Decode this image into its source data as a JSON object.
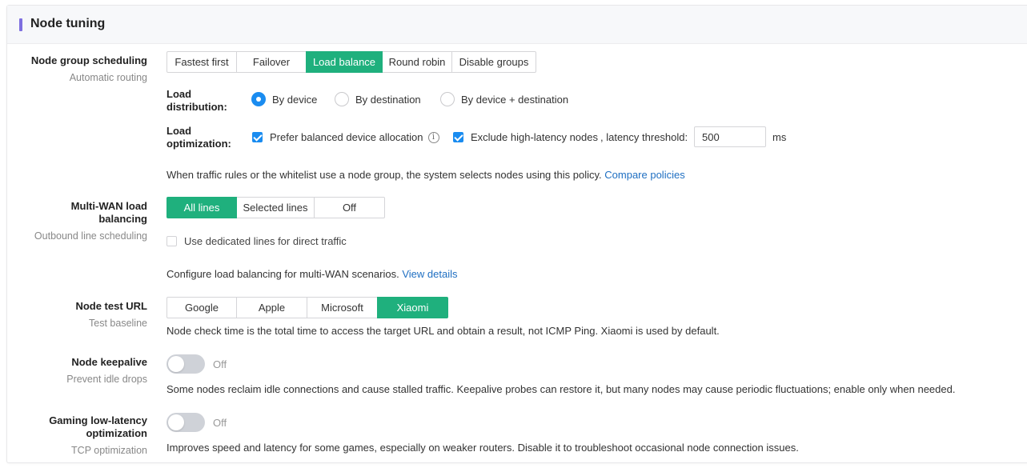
{
  "header": {
    "title": "Node tuning"
  },
  "group_scheduling": {
    "label": "Node group scheduling",
    "sublabel": "Automatic routing",
    "options": [
      "Fastest first",
      "Failover",
      "Load balance",
      "Round robin",
      "Disable groups"
    ],
    "selected": "Load balance",
    "distribution": {
      "label_line1": "Load",
      "label_line2": "distribution:",
      "options": [
        "By device",
        "By destination",
        "By device + destination"
      ],
      "selected": "By device"
    },
    "optimization": {
      "label_line1": "Load",
      "label_line2": "optimization:",
      "prefer_balanced": {
        "label": "Prefer balanced device allocation",
        "checked": true
      },
      "exclude_high_latency": {
        "label": "Exclude high-latency nodes",
        "checked": true
      },
      "threshold_label": ", latency threshold:",
      "threshold_value": "500",
      "threshold_unit": "ms"
    },
    "help_text": "When traffic rules or the whitelist use a node group, the system selects nodes using this policy.",
    "help_link": "Compare policies"
  },
  "multiwan": {
    "label_line1": "Multi-WAN load",
    "label_line2": "balancing",
    "sublabel": "Outbound line scheduling",
    "options": [
      "All lines",
      "Selected lines",
      "Off"
    ],
    "selected": "All lines",
    "dedicated_lines": {
      "label": "Use dedicated lines for direct traffic",
      "checked": false
    },
    "help_text": "Configure load balancing for multi-WAN scenarios.",
    "help_link": "View details"
  },
  "test_url": {
    "label": "Node test URL",
    "sublabel": "Test baseline",
    "options": [
      "Google",
      "Apple",
      "Microsoft",
      "Xiaomi"
    ],
    "selected": "Xiaomi",
    "help_text": "Node check time is the total time to access the target URL and obtain a result, not ICMP Ping. Xiaomi is used by default."
  },
  "keepalive": {
    "label": "Node keepalive",
    "sublabel": "Prevent idle drops",
    "state_text": "Off",
    "help_text": "Some nodes reclaim idle connections and cause stalled traffic. Keepalive probes can restore it, but many nodes may cause periodic fluctuations; enable only when needed."
  },
  "gaming": {
    "label_line1": "Gaming low-latency",
    "label_line2": "optimization",
    "sublabel": "TCP optimization",
    "state_text": "Off",
    "help_text": "Improves speed and latency for some games, especially on weaker routers. Disable it to troubleshoot occasional node connection issues."
  },
  "colors": {
    "accent_green": "#1fb07d",
    "accent_blue": "#1a8cf0",
    "header_bar": "#7e6fe0",
    "link": "#1f6fc2"
  }
}
